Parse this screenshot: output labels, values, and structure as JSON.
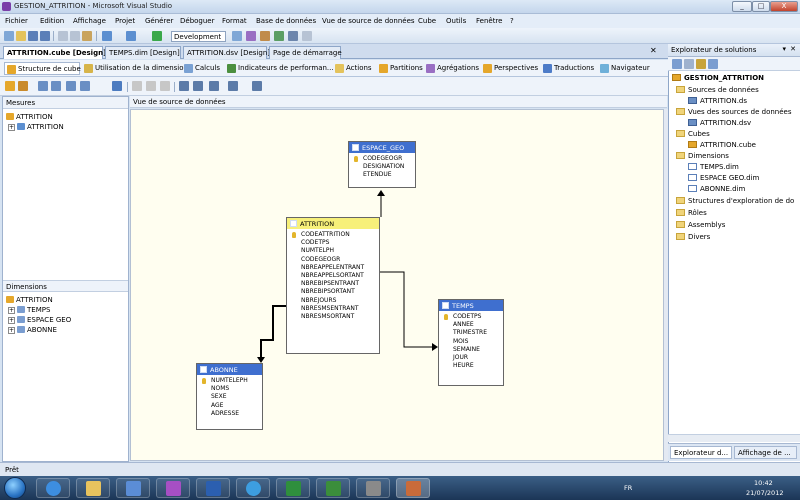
{
  "window": {
    "title": "GESTION_ATTRITION - Microsoft Visual Studio",
    "controls": [
      "_",
      "□",
      "X"
    ]
  },
  "menu": [
    "Fichier",
    "Edition",
    "Affichage",
    "Projet",
    "Générer",
    "Déboguer",
    "Format",
    "Base de données",
    "Vue de source de données",
    "Cube",
    "Outils",
    "Fenêtre",
    "?"
  ],
  "toolbar": {
    "configuration": "Development"
  },
  "document_tabs": [
    "ATTRITION.cube [Design]*",
    "TEMPS.dim [Design]",
    "ATTRITION.dsv [Design]",
    "Page de démarrage"
  ],
  "designer_tabs": [
    "Structure de cube",
    "Utilisation de la dimension",
    "Calculs",
    "Indicateurs de performan...",
    "Actions",
    "Partitions",
    "Agrégations",
    "Perspectives",
    "Traductions",
    "Navigateur"
  ],
  "measures_panel": {
    "title": "Mesures",
    "root": "ATTRITION",
    "child": "ATTRITION"
  },
  "dimensions_panel": {
    "title": "Dimensions",
    "root": "ATTRITION",
    "items": [
      "TEMPS",
      "ESPACE GEO",
      "ABONNE"
    ]
  },
  "dsv_header": "Vue de source de données",
  "tables": {
    "espace_geo": {
      "name": "ESPACE_GEO",
      "columns": [
        "CODEGEOGR",
        "DESIGNATION",
        "ETENDUE"
      ],
      "keys": [
        0
      ]
    },
    "attrition": {
      "name": "ATTRITION",
      "columns": [
        "CODEATTRITION",
        "CODETPS",
        "NUMTELPH",
        "CODEGEOGR",
        "NBREAPPELENTRANT",
        "NBREAPPELSORTANT",
        "NBREBIPSENTRANT",
        "NBREBIPSORTANT",
        "NBREJOURS",
        "NBRESMSENTRANT",
        "NBRESMSORTANT"
      ],
      "keys": [
        0
      ]
    },
    "temps": {
      "name": "TEMPS",
      "columns": [
        "CODETPS",
        "ANNEE",
        "TRIMESTRE",
        "MOIS",
        "SEMAINE",
        "JOUR",
        "HEURE"
      ],
      "keys": [
        0
      ]
    },
    "abonne": {
      "name": "ABONNE",
      "columns": [
        "NUMTELEPH",
        "NOMS",
        "SEXE",
        "AGE",
        "ADRESSE"
      ],
      "keys": [
        0
      ]
    }
  },
  "solution_explorer": {
    "title": "Explorateur de solutions",
    "project": "GESTION_ATTRITION",
    "nodes": [
      {
        "label": "Sources de données",
        "children": [
          "ATTRITION.ds"
        ]
      },
      {
        "label": "Vues des sources de données",
        "children": [
          "ATTRITION.dsv"
        ]
      },
      {
        "label": "Cubes",
        "children": [
          "ATTRITION.cube"
        ]
      },
      {
        "label": "Dimensions",
        "children": [
          "TEMPS.dim",
          "ESPACE GEO.dim",
          "ABONNE.dim"
        ]
      },
      {
        "label": "Structures d'exploration de do",
        "children": []
      },
      {
        "label": "Rôles",
        "children": []
      },
      {
        "label": "Assemblys",
        "children": []
      },
      {
        "label": "Divers",
        "children": []
      }
    ]
  },
  "bottom_tabs": [
    "Explorateur d...",
    "Affichage de ..."
  ],
  "status": "Prêt",
  "taskbar": {
    "lang": "FR",
    "time": "10:42",
    "date": "21/07/2012"
  }
}
